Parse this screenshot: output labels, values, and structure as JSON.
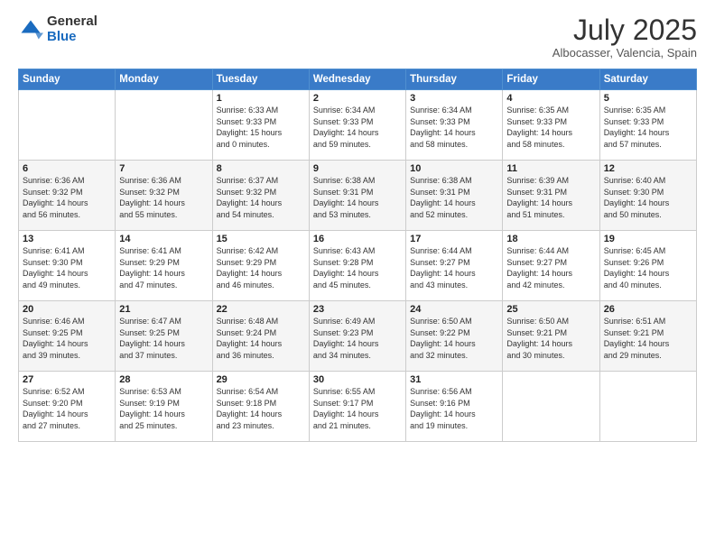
{
  "header": {
    "logo_general": "General",
    "logo_blue": "Blue",
    "month_title": "July 2025",
    "location": "Albocasser, Valencia, Spain"
  },
  "weekdays": [
    "Sunday",
    "Monday",
    "Tuesday",
    "Wednesday",
    "Thursday",
    "Friday",
    "Saturday"
  ],
  "weeks": [
    [
      {
        "day": "",
        "info": ""
      },
      {
        "day": "",
        "info": ""
      },
      {
        "day": "1",
        "info": "Sunrise: 6:33 AM\nSunset: 9:33 PM\nDaylight: 15 hours\nand 0 minutes."
      },
      {
        "day": "2",
        "info": "Sunrise: 6:34 AM\nSunset: 9:33 PM\nDaylight: 14 hours\nand 59 minutes."
      },
      {
        "day": "3",
        "info": "Sunrise: 6:34 AM\nSunset: 9:33 PM\nDaylight: 14 hours\nand 58 minutes."
      },
      {
        "day": "4",
        "info": "Sunrise: 6:35 AM\nSunset: 9:33 PM\nDaylight: 14 hours\nand 58 minutes."
      },
      {
        "day": "5",
        "info": "Sunrise: 6:35 AM\nSunset: 9:33 PM\nDaylight: 14 hours\nand 57 minutes."
      }
    ],
    [
      {
        "day": "6",
        "info": "Sunrise: 6:36 AM\nSunset: 9:32 PM\nDaylight: 14 hours\nand 56 minutes."
      },
      {
        "day": "7",
        "info": "Sunrise: 6:36 AM\nSunset: 9:32 PM\nDaylight: 14 hours\nand 55 minutes."
      },
      {
        "day": "8",
        "info": "Sunrise: 6:37 AM\nSunset: 9:32 PM\nDaylight: 14 hours\nand 54 minutes."
      },
      {
        "day": "9",
        "info": "Sunrise: 6:38 AM\nSunset: 9:31 PM\nDaylight: 14 hours\nand 53 minutes."
      },
      {
        "day": "10",
        "info": "Sunrise: 6:38 AM\nSunset: 9:31 PM\nDaylight: 14 hours\nand 52 minutes."
      },
      {
        "day": "11",
        "info": "Sunrise: 6:39 AM\nSunset: 9:31 PM\nDaylight: 14 hours\nand 51 minutes."
      },
      {
        "day": "12",
        "info": "Sunrise: 6:40 AM\nSunset: 9:30 PM\nDaylight: 14 hours\nand 50 minutes."
      }
    ],
    [
      {
        "day": "13",
        "info": "Sunrise: 6:41 AM\nSunset: 9:30 PM\nDaylight: 14 hours\nand 49 minutes."
      },
      {
        "day": "14",
        "info": "Sunrise: 6:41 AM\nSunset: 9:29 PM\nDaylight: 14 hours\nand 47 minutes."
      },
      {
        "day": "15",
        "info": "Sunrise: 6:42 AM\nSunset: 9:29 PM\nDaylight: 14 hours\nand 46 minutes."
      },
      {
        "day": "16",
        "info": "Sunrise: 6:43 AM\nSunset: 9:28 PM\nDaylight: 14 hours\nand 45 minutes."
      },
      {
        "day": "17",
        "info": "Sunrise: 6:44 AM\nSunset: 9:27 PM\nDaylight: 14 hours\nand 43 minutes."
      },
      {
        "day": "18",
        "info": "Sunrise: 6:44 AM\nSunset: 9:27 PM\nDaylight: 14 hours\nand 42 minutes."
      },
      {
        "day": "19",
        "info": "Sunrise: 6:45 AM\nSunset: 9:26 PM\nDaylight: 14 hours\nand 40 minutes."
      }
    ],
    [
      {
        "day": "20",
        "info": "Sunrise: 6:46 AM\nSunset: 9:25 PM\nDaylight: 14 hours\nand 39 minutes."
      },
      {
        "day": "21",
        "info": "Sunrise: 6:47 AM\nSunset: 9:25 PM\nDaylight: 14 hours\nand 37 minutes."
      },
      {
        "day": "22",
        "info": "Sunrise: 6:48 AM\nSunset: 9:24 PM\nDaylight: 14 hours\nand 36 minutes."
      },
      {
        "day": "23",
        "info": "Sunrise: 6:49 AM\nSunset: 9:23 PM\nDaylight: 14 hours\nand 34 minutes."
      },
      {
        "day": "24",
        "info": "Sunrise: 6:50 AM\nSunset: 9:22 PM\nDaylight: 14 hours\nand 32 minutes."
      },
      {
        "day": "25",
        "info": "Sunrise: 6:50 AM\nSunset: 9:21 PM\nDaylight: 14 hours\nand 30 minutes."
      },
      {
        "day": "26",
        "info": "Sunrise: 6:51 AM\nSunset: 9:21 PM\nDaylight: 14 hours\nand 29 minutes."
      }
    ],
    [
      {
        "day": "27",
        "info": "Sunrise: 6:52 AM\nSunset: 9:20 PM\nDaylight: 14 hours\nand 27 minutes."
      },
      {
        "day": "28",
        "info": "Sunrise: 6:53 AM\nSunset: 9:19 PM\nDaylight: 14 hours\nand 25 minutes."
      },
      {
        "day": "29",
        "info": "Sunrise: 6:54 AM\nSunset: 9:18 PM\nDaylight: 14 hours\nand 23 minutes."
      },
      {
        "day": "30",
        "info": "Sunrise: 6:55 AM\nSunset: 9:17 PM\nDaylight: 14 hours\nand 21 minutes."
      },
      {
        "day": "31",
        "info": "Sunrise: 6:56 AM\nSunset: 9:16 PM\nDaylight: 14 hours\nand 19 minutes."
      },
      {
        "day": "",
        "info": ""
      },
      {
        "day": "",
        "info": ""
      }
    ]
  ]
}
